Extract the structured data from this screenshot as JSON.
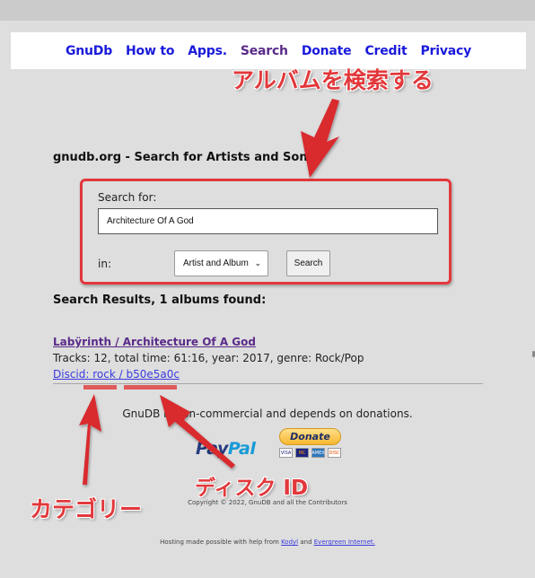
{
  "nav": {
    "items": [
      {
        "label": "GnuDb"
      },
      {
        "label": "How to"
      },
      {
        "label": "Apps."
      },
      {
        "label": "Search"
      },
      {
        "label": "Donate"
      },
      {
        "label": "Credit"
      },
      {
        "label": "Privacy"
      }
    ],
    "visited_color": "#5a2b8a",
    "link_color": "#1a1adb"
  },
  "page": {
    "title": "gnudb.org - Search for Artists and Songs"
  },
  "search": {
    "label": "Search for:",
    "value": "Architecture Of A God",
    "in_label": "in:",
    "scope_selected": "Artist and Album",
    "button_label": "Search"
  },
  "results": {
    "heading": "Search Results, 1 albums found:",
    "items": [
      {
        "title": "Labÿrinth / Architecture Of A God",
        "meta": "Tracks: 12, total time: 61:16, year: 2017, genre: Rock/Pop",
        "discid": "Discid: rock / b50e5a0c"
      }
    ]
  },
  "footer": {
    "donation_text": "GnuDB is non-commercial and depends on donations.",
    "paypal_logo": {
      "part1": "Pay",
      "part2": "Pal"
    },
    "donate_button": "Donate",
    "cards": [
      "VISA",
      "MC",
      "AMEX",
      "DISC"
    ],
    "copyright": "Copyright © 2022, GnuDB and all the Contributors",
    "hosting_prefix": "Hosting made possible with help from ",
    "hosting_link1": "Kodyl",
    "hosting_mid": " and ",
    "hosting_link2": "Evergreen Internet."
  },
  "annotations": {
    "search_album": "アルバムを検索する",
    "category": "カテゴリー",
    "disc_id": "ディスク ID",
    "accent_color": "#e2383b"
  }
}
